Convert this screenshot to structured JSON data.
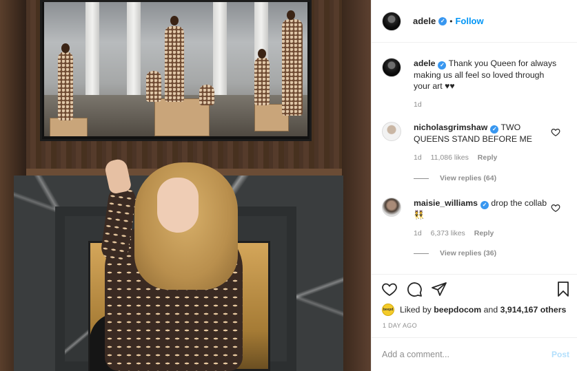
{
  "post": {
    "image_alt": "Woman in crescent-print bodysuit posing in front of a marble fireplace below a TV",
    "header": {
      "username": "adele",
      "verified_icon": "verified-badge-icon",
      "separator": "•",
      "follow_label": "Follow"
    },
    "caption": {
      "username": "adele",
      "text": "Thank you Queen for always making us all feel so loved through your art ♥♥",
      "time": "1d"
    },
    "comments": [
      {
        "username": "nicholasgrimshaw",
        "text": "TWO QUEENS STAND BEFORE ME",
        "time": "1d",
        "likes": "11,086 likes",
        "reply_label": "Reply",
        "view_replies": "View replies (64)"
      },
      {
        "username": "maisie_williams",
        "text": "drop the collab 👯",
        "time": "1d",
        "likes": "6,373 likes",
        "reply_label": "Reply",
        "view_replies": "View replies (36)"
      }
    ],
    "liked_by": {
      "prefix": "Liked by",
      "user": "beepdocom",
      "middle": "and",
      "count": "3,914,167 others",
      "avatar_text": "beepd"
    },
    "time_ago": "1 DAY AGO",
    "add_comment": {
      "placeholder": "Add a comment...",
      "post_label": "Post"
    }
  },
  "colors": {
    "accent": "#0095f6",
    "verified": "#3897f0",
    "muted": "#8e8e8e",
    "post_disabled": "#b2dffc"
  }
}
